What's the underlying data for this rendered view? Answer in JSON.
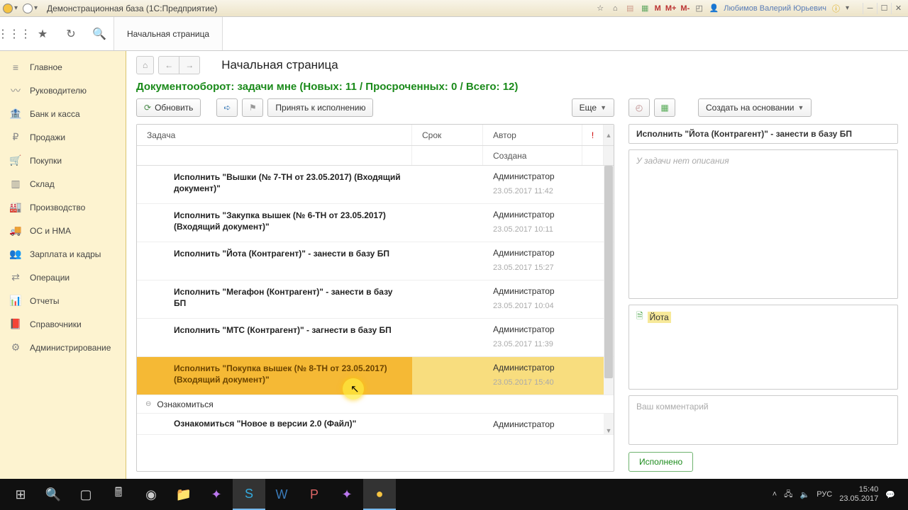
{
  "titlebar": {
    "title": "Демонстрационная база  (1С:Предприятие)",
    "m_label": "М",
    "m_plus": "М+",
    "m_minus": "М-",
    "user": "Любимов Валерий Юрьевич"
  },
  "toptool": {
    "tab_label": "Начальная страница"
  },
  "sidebar": {
    "items": [
      {
        "icon": "≡",
        "label": "Главное"
      },
      {
        "icon": "〰",
        "label": "Руководителю"
      },
      {
        "icon": "🏦",
        "label": "Банк и касса"
      },
      {
        "icon": "₽",
        "label": "Продажи"
      },
      {
        "icon": "🛒",
        "label": "Покупки"
      },
      {
        "icon": "▥",
        "label": "Склад"
      },
      {
        "icon": "🏭",
        "label": "Производство"
      },
      {
        "icon": "🚚",
        "label": "ОС и НМА"
      },
      {
        "icon": "👥",
        "label": "Зарплата и кадры"
      },
      {
        "icon": "⇄",
        "label": "Операции"
      },
      {
        "icon": "📊",
        "label": "Отчеты"
      },
      {
        "icon": "📕",
        "label": "Справочники"
      },
      {
        "icon": "⚙",
        "label": "Администрирование"
      }
    ]
  },
  "page": {
    "title": "Начальная страница",
    "status_line": "Документооборот: задачи мне (Новых: 11 / Просроченных: 0 / Всего: 12)"
  },
  "left_toolbar": {
    "refresh": "Обновить",
    "accept": "Принять к исполнению",
    "more": "Еще"
  },
  "right_toolbar": {
    "create_based": "Создать на основании"
  },
  "columns": {
    "task": "Задача",
    "due": "Срок",
    "author": "Автор",
    "priority": "!",
    "created": "Создана"
  },
  "tasks": [
    {
      "task": "Исполнить \"Вышки (№ 7-ТН от 23.05.2017) (Входящий документ)\"",
      "author": "Администратор",
      "created": "23.05.2017 11:42"
    },
    {
      "task": "Исполнить \"Закупка вышек (№ 6-ТН от 23.05.2017) (Входящий документ)\"",
      "author": "Администратор",
      "created": "23.05.2017 10:11"
    },
    {
      "task": "Исполнить \"Йота (Контрагент)\" - занести в базу БП",
      "author": "Администратор",
      "created": "23.05.2017 15:27"
    },
    {
      "task": "Исполнить \"Мегафон (Контрагент)\" - занести в базу БП",
      "author": "Администратор",
      "created": "23.05.2017 10:04"
    },
    {
      "task": "Исполнить \"МТС (Контрагент)\" - загнести в базу БП",
      "author": "Администратор",
      "created": "23.05.2017 11:39"
    },
    {
      "task": "Исполнить \"Покупка вышек (№ 8-ТН от 23.05.2017) (Входящий документ)\"",
      "author": "Администратор",
      "created": "23.05.2017 15:40",
      "selected": true
    }
  ],
  "group_label": "Ознакомиться",
  "last_task": {
    "task": "Ознакомиться \"Новое в версии 2.0 (Файл)\"",
    "author": "Администратор"
  },
  "detail": {
    "title": "Исполнить \"Йота (Контрагент)\" - занести в базу БП",
    "no_desc": "У задачи нет описания",
    "attachment": "Йота",
    "comment_placeholder": "Ваш комментарий",
    "done": "Исполнено"
  },
  "tray": {
    "lang": "РУС",
    "time": "15:40",
    "date": "23.05.2017"
  }
}
